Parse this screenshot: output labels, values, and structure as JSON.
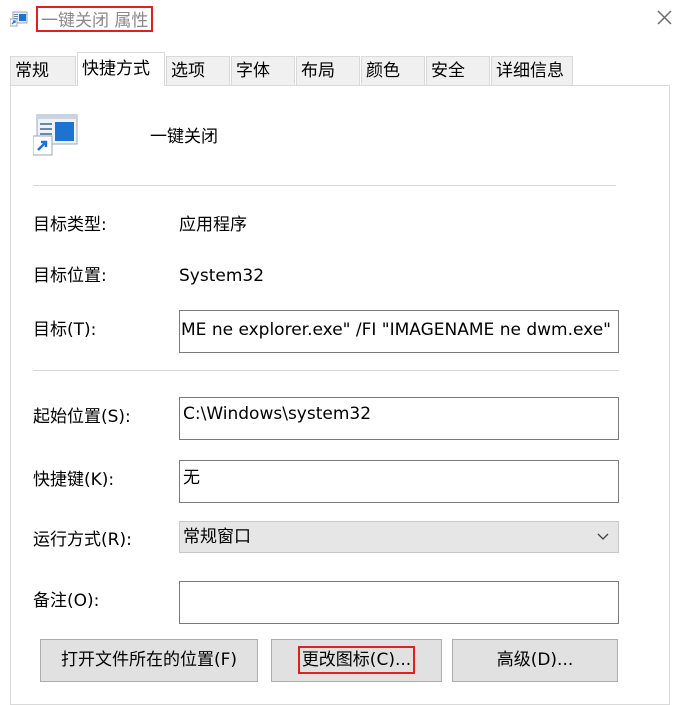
{
  "window": {
    "title": "一键关闭 属性",
    "close_icon": "close-icon"
  },
  "tabs": [
    {
      "label": "常规"
    },
    {
      "label": "快捷方式",
      "active": true
    },
    {
      "label": "选项"
    },
    {
      "label": "字体"
    },
    {
      "label": "布局"
    },
    {
      "label": "颜色"
    },
    {
      "label": "安全"
    },
    {
      "label": "详细信息"
    }
  ],
  "shortcut": {
    "name": "一键关闭",
    "target_type_label": "目标类型:",
    "target_type_value": "应用程序",
    "target_location_label": "目标位置:",
    "target_location_value": "System32",
    "target_label": "目标(T):",
    "target_value": "ME ne explorer.exe\" /FI \"IMAGENAME ne dwm.exe\"",
    "start_in_label": "起始位置(S):",
    "start_in_value": "C:\\Windows\\system32",
    "hotkey_label": "快捷键(K):",
    "hotkey_value": "无",
    "run_label": "运行方式(R):",
    "run_value": "常规窗口",
    "comment_label": "备注(O):",
    "comment_value": ""
  },
  "buttons": {
    "open_location": "打开文件所在的位置(F)",
    "change_icon": "更改图标(C)...",
    "advanced": "高级(D)..."
  },
  "colors": {
    "highlight": "#e02020",
    "icon_blue": "#1e73d2"
  }
}
